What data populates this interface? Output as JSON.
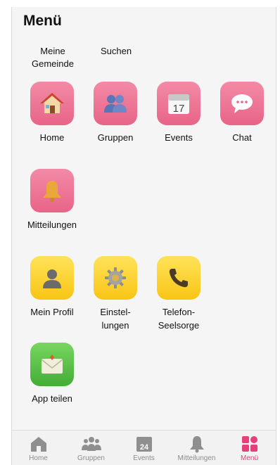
{
  "page_title": "Menü",
  "top_links": [
    {
      "label": "Meine\nGemeinde"
    },
    {
      "label": "Suchen"
    }
  ],
  "tiles": [
    {
      "label": "Home",
      "icon": "house-icon",
      "color": "#ec7596"
    },
    {
      "label": "Gruppen",
      "icon": "people-icon",
      "color": "#ec7596"
    },
    {
      "label": "Events",
      "icon": "calendar-icon",
      "color": "#ec7596",
      "calendar_day": "17"
    },
    {
      "label": "Chat",
      "icon": "speech-bubble-icon",
      "color": "#ec7596"
    },
    {
      "label": "Mitteilungen",
      "icon": "bell-icon",
      "color": "#ec7596"
    },
    {
      "label": "Mein Profil",
      "icon": "person-icon",
      "color": "#fcd535"
    },
    {
      "label": "Einstel-\nlungen",
      "icon": "gear-icon",
      "color": "#fcd535"
    },
    {
      "label": "Telefon-\nSeelsorge",
      "icon": "phone-icon",
      "color": "#fcd535"
    },
    {
      "label": "App teilen",
      "icon": "envelope-icon",
      "color": "#5cc24a"
    }
  ],
  "tabbar": {
    "accent": "#e5407a",
    "items": [
      {
        "label": "Home",
        "icon": "house-icon"
      },
      {
        "label": "Gruppen",
        "icon": "people-icon"
      },
      {
        "label": "Events",
        "icon": "calendar-icon",
        "calendar_day": "24"
      },
      {
        "label": "Mitteilungen",
        "icon": "bell-icon"
      },
      {
        "label": "Menü",
        "icon": "grid-icon",
        "active": true
      }
    ]
  }
}
